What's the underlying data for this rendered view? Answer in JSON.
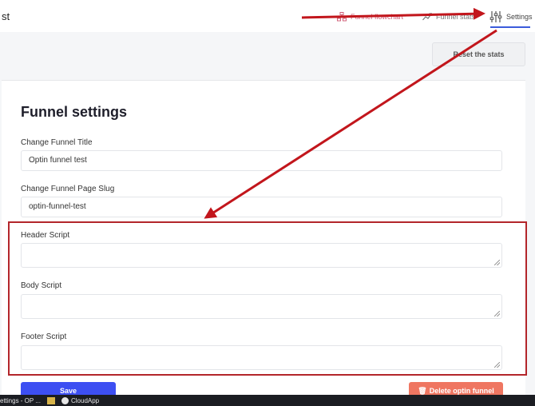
{
  "header": {
    "app_title": "st",
    "nav": [
      {
        "label": "Funnel flowchart",
        "icon": "flowchart-icon"
      },
      {
        "label": "Funnel stats",
        "icon": "chart-icon"
      },
      {
        "label": "Settings",
        "icon": "sliders-icon"
      }
    ],
    "reset_label": "Reset the stats"
  },
  "settings": {
    "title": "Funnel settings",
    "funnel_title_label": "Change Funnel Title",
    "funnel_title_value": "Optin funnel test",
    "slug_label": "Change Funnel Page Slug",
    "slug_value": "optin-funnel-test",
    "header_script_label": "Header Script",
    "body_script_label": "Body Script",
    "footer_script_label": "Footer Script",
    "save_label": "Save",
    "delete_label": "Delete optin funnel"
  },
  "taskbar": {
    "items": [
      "ettings - OP ...",
      "CloudApp"
    ]
  },
  "annotation": {
    "color": "#b3262b",
    "accent_color": "#3b5bdb"
  }
}
